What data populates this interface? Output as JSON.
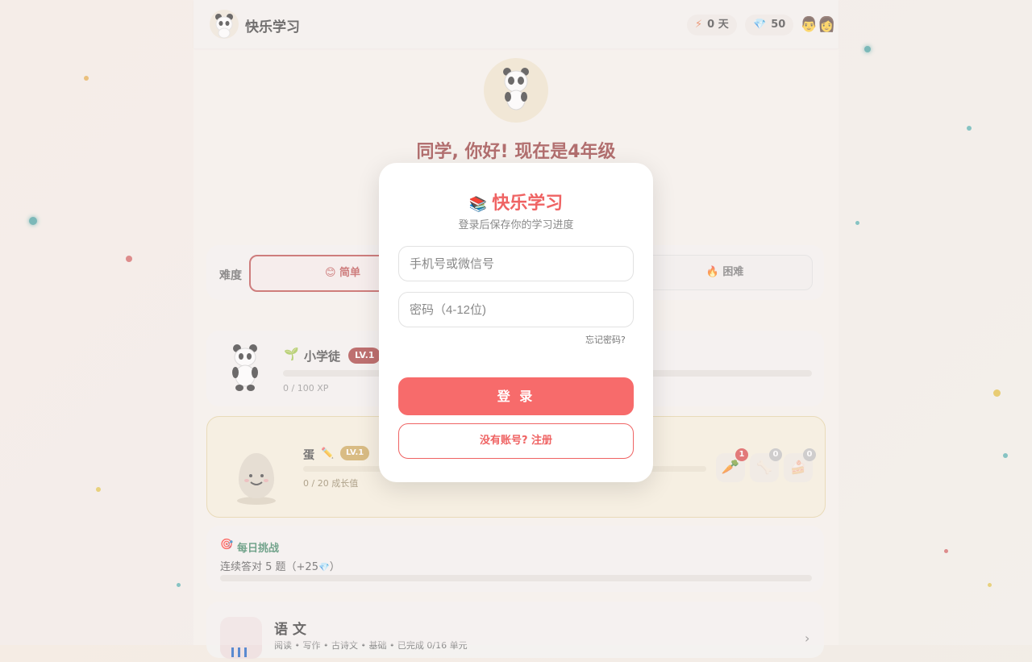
{
  "app": {
    "title": "快乐学习"
  },
  "header": {
    "streak": "0 天",
    "gems": "50"
  },
  "hero": {
    "greeting": "同学, 你好! 现在是4年级"
  },
  "difficulty": {
    "label": "难度",
    "options": [
      "简单",
      "困难"
    ],
    "selected": "简单"
  },
  "level": {
    "name": "小学徒",
    "badge": "LV.1",
    "xp": "0 / 100 XP"
  },
  "pet": {
    "name": "蛋",
    "badge": "LV.1",
    "growth": "0 / 20 成长值",
    "food_counts": [
      "1",
      "0",
      "0"
    ]
  },
  "challenge": {
    "title": "每日挑战",
    "text": "连续答对 5 题（+25",
    "text_end": "）"
  },
  "subject": {
    "name": "语 文",
    "meta": "阅读 • 写作 • 古诗文 • 基础 • 已完成 0/16 单元"
  },
  "login_modal": {
    "title": "快乐学习",
    "subtitle": "登录后保存你的学习进度",
    "phone_placeholder": "手机号或微信号",
    "password_placeholder": "密码（4-12位)",
    "forgot": "忘记密码?",
    "login_button": "登 录",
    "register_button": "没有账号? 注册"
  },
  "colors": {
    "primary": "#f76b6b",
    "greeting": "#8e2a2a",
    "badge": "#a02b2b"
  }
}
